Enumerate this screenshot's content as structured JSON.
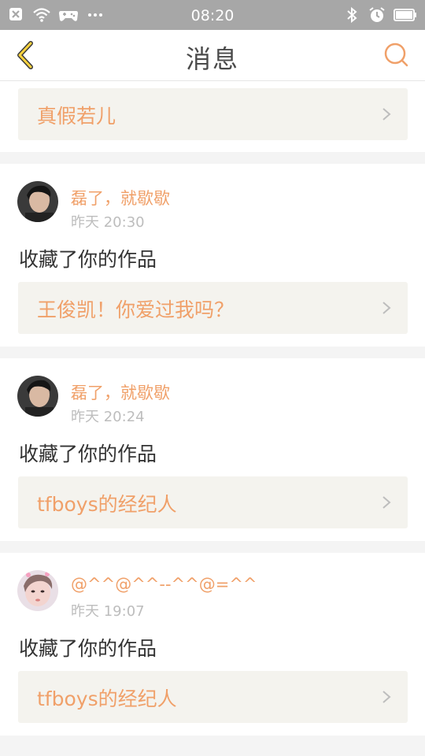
{
  "status_bar": {
    "time": "08:20",
    "left_icons": [
      "close-box-icon",
      "wifi-icon",
      "gamepad-icon",
      "more-dots-icon"
    ],
    "right_icons": [
      "bluetooth-icon",
      "alarm-icon",
      "battery-icon"
    ]
  },
  "header": {
    "title": "消息"
  },
  "top_item": {
    "work_title": "真假若儿"
  },
  "messages": [
    {
      "user_name": "磊了，就歇歇",
      "time": "昨天 20:30",
      "action": "收藏了你的作品",
      "work_title": "王俊凯！你爱过我吗？"
    },
    {
      "user_name": "磊了，就歇歇",
      "time": "昨天 20:24",
      "action": "收藏了你的作品",
      "work_title": "tfboys的经纪人"
    },
    {
      "user_name": "@^^@^^--^^@=^^",
      "time": "昨天 19:07",
      "action": "收藏了你的作品",
      "work_title": "tfboys的经纪人"
    }
  ],
  "colors": {
    "accent": "#f0a069",
    "status_bar": "#a7a7a7",
    "card_link_bg": "#f4f3ee"
  }
}
